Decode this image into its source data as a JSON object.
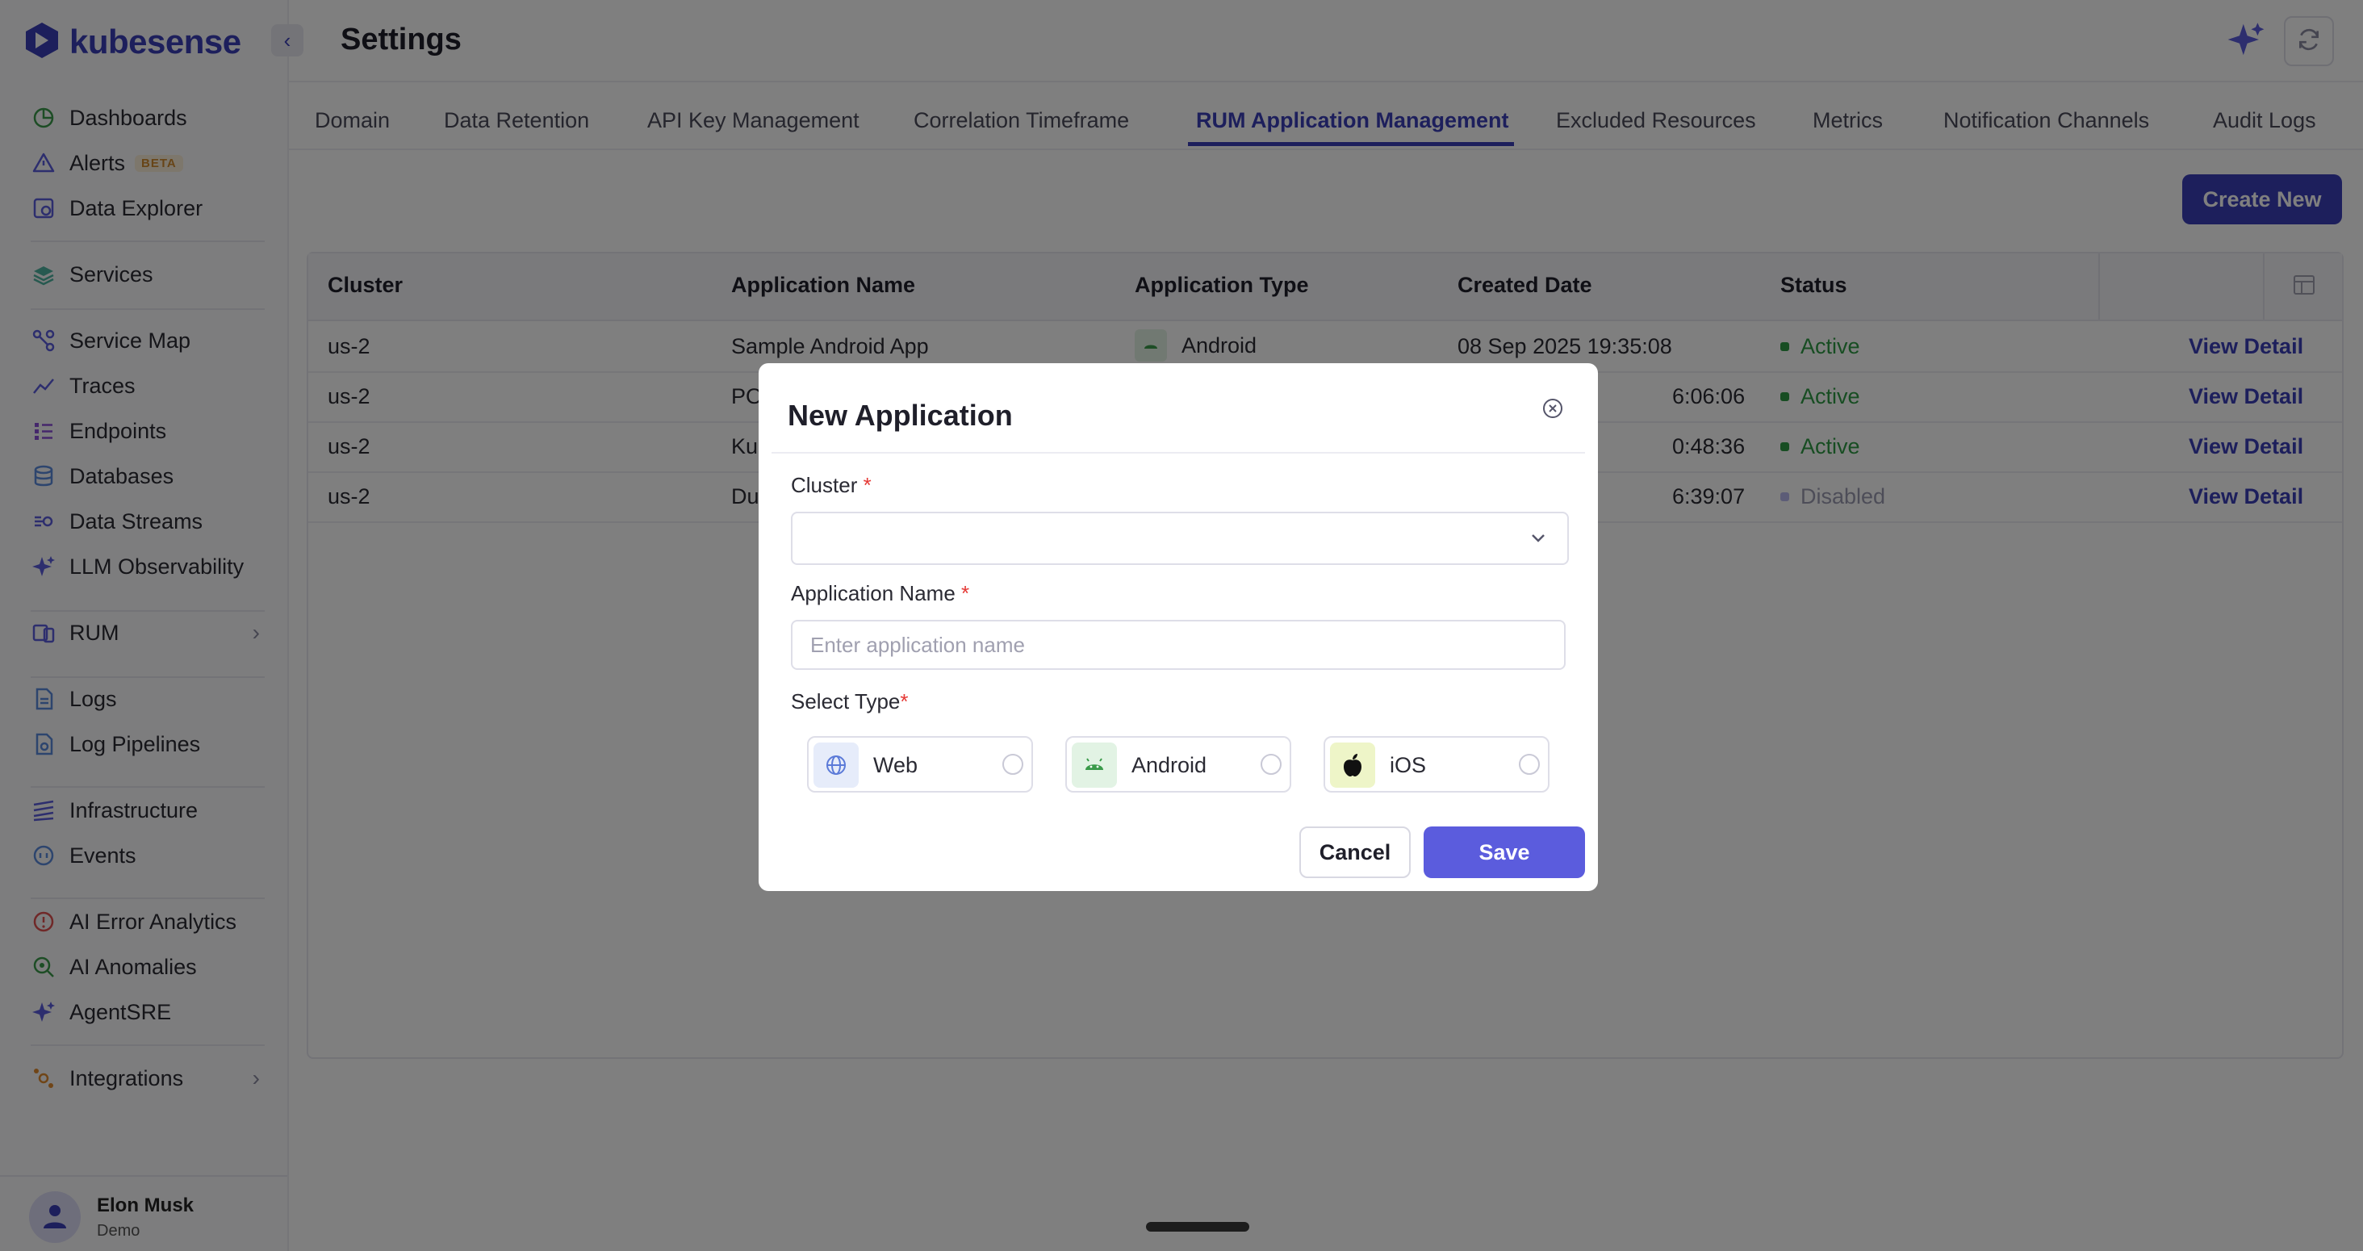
{
  "brand": {
    "name": "kubesense",
    "accent": "#3b3fb8"
  },
  "header": {
    "title": "Settings"
  },
  "sidebar": {
    "items": [
      {
        "label": "Dashboards",
        "icon": "dashboard-icon"
      },
      {
        "label": "Alerts",
        "badge": "BETA",
        "icon": "alert-icon"
      },
      {
        "label": "Data Explorer",
        "icon": "data-explorer-icon"
      },
      {
        "label": "Services",
        "icon": "services-icon"
      },
      {
        "label": "Service Map",
        "icon": "service-map-icon"
      },
      {
        "label": "Traces",
        "icon": "traces-icon"
      },
      {
        "label": "Endpoints",
        "icon": "endpoints-icon"
      },
      {
        "label": "Databases",
        "icon": "database-icon"
      },
      {
        "label": "Data Streams",
        "icon": "data-streams-icon"
      },
      {
        "label": "LLM Observability",
        "icon": "sparkle-icon"
      },
      {
        "label": "RUM",
        "icon": "rum-icon"
      },
      {
        "label": "Logs",
        "icon": "logs-icon"
      },
      {
        "label": "Log Pipelines",
        "icon": "log-pipelines-icon"
      },
      {
        "label": "Infrastructure",
        "icon": "infrastructure-icon"
      },
      {
        "label": "Events",
        "icon": "events-icon"
      },
      {
        "label": "AI Error Analytics",
        "icon": "error-analytics-icon"
      },
      {
        "label": "AI Anomalies",
        "icon": "anomalies-icon"
      },
      {
        "label": "AgentSRE",
        "icon": "agent-sparkle-icon"
      },
      {
        "label": "Integrations",
        "icon": "integrations-icon"
      }
    ],
    "user": {
      "name": "Elon Musk",
      "role": "Demo"
    }
  },
  "tabs": [
    {
      "label": "Domain"
    },
    {
      "label": "Data Retention"
    },
    {
      "label": "API Key Management"
    },
    {
      "label": "Correlation Timeframe"
    },
    {
      "label": "RUM Application Management",
      "active": true
    },
    {
      "label": "Excluded Resources"
    },
    {
      "label": "Metrics"
    },
    {
      "label": "Notification Channels"
    },
    {
      "label": "Audit Logs"
    }
  ],
  "actions": {
    "create_new": "Create New"
  },
  "table": {
    "columns": [
      "Cluster",
      "Application Name",
      "Application Type",
      "Created Date",
      "Status"
    ],
    "rows": [
      {
        "cluster": "us-2",
        "name": "Sample Android App",
        "type": "Android",
        "created": "08 Sep 2025 19:35:08",
        "status": "Active",
        "action": "View Detail"
      },
      {
        "cluster": "us-2",
        "name": "PO",
        "type": "",
        "created": "6:06:06",
        "status": "Active",
        "action": "View Detail"
      },
      {
        "cluster": "us-2",
        "name": "Kul",
        "type": "",
        "created": "0:48:36",
        "status": "Active",
        "action": "View Detail"
      },
      {
        "cluster": "us-2",
        "name": "Du",
        "type": "",
        "created": "6:39:07",
        "status": "Disabled",
        "action": "View Detail"
      }
    ],
    "status_colors": {
      "Active": "#2e9a45",
      "Disabled": "#9a9ab0"
    }
  },
  "modal": {
    "title": "New Application",
    "cluster_label": "Cluster",
    "cluster_value": "",
    "app_name_label": "Application Name",
    "app_name_value": "",
    "app_name_placeholder": "Enter application name",
    "select_type_label": "Select Type",
    "required_mark": "*",
    "types": [
      {
        "label": "Web",
        "icon": "globe-icon"
      },
      {
        "label": "Android",
        "icon": "android-icon"
      },
      {
        "label": "iOS",
        "icon": "apple-icon"
      }
    ],
    "cancel": "Cancel",
    "save": "Save"
  }
}
